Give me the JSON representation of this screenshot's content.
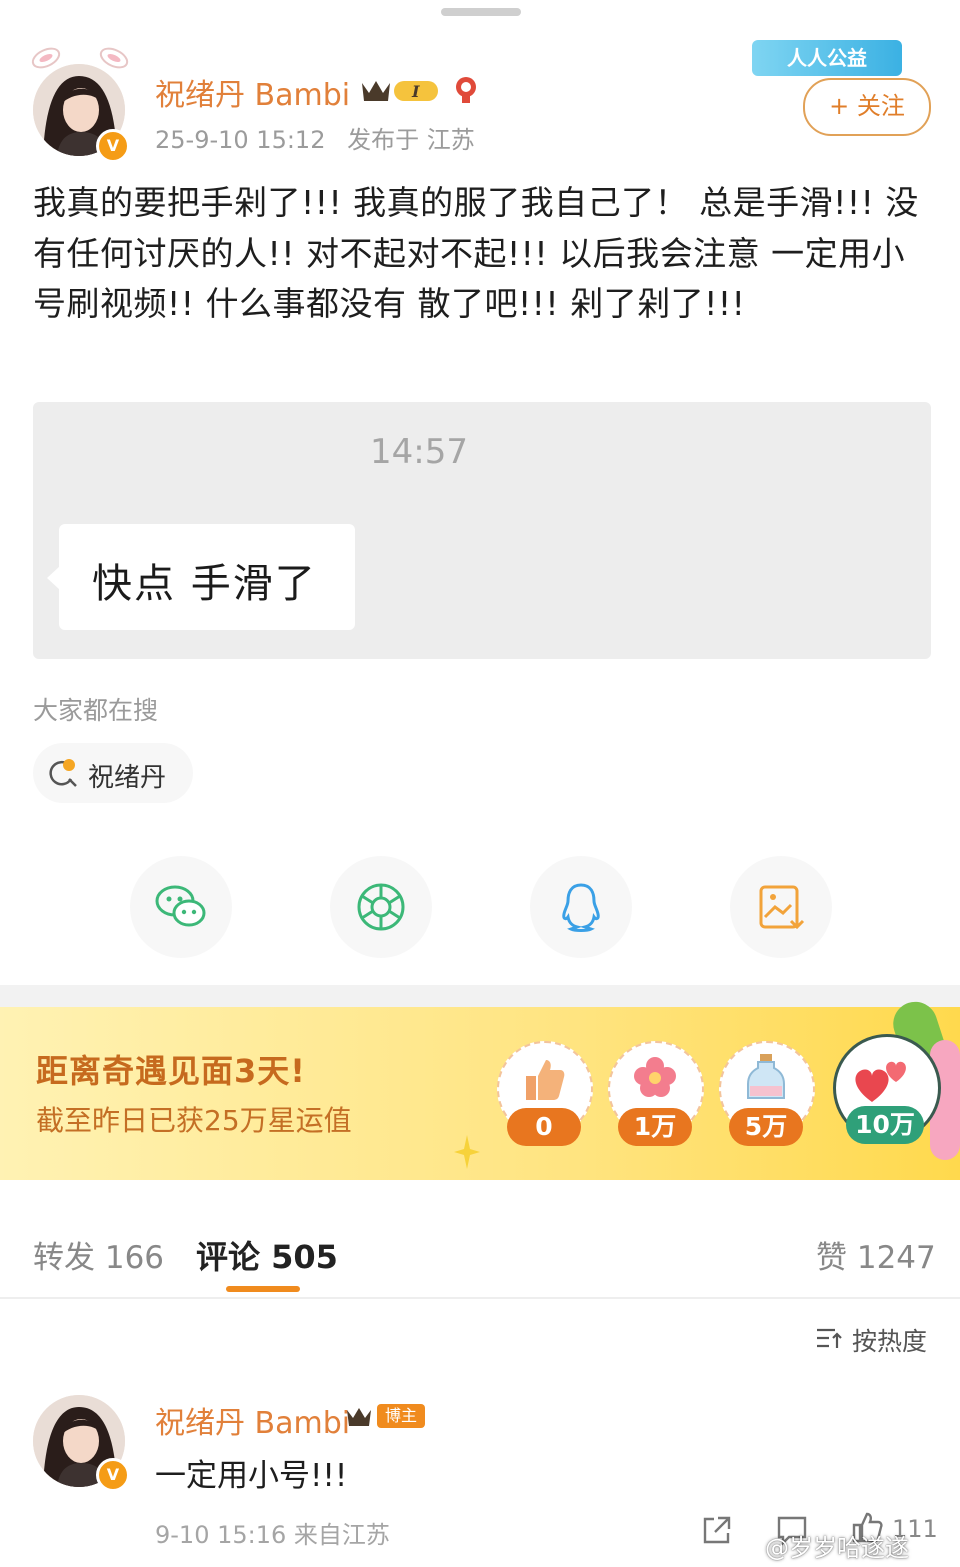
{
  "post": {
    "author": "祝绪丹 Bambi",
    "verified_mark": "V",
    "time": "25-9-10 15:12",
    "location": "发布于 江苏",
    "badge_charity": "人人公益",
    "follow_label": "+ 关注",
    "text": "我真的要把手剁了!!! 我真的服了我自己了！ 总是手滑!!! 没有任何讨厌的人!! 对不起对不起!!! 以后我会注意 一定用小号刷视频!! 什么事都没有 散了吧!!! 剁了剁了!!!",
    "image": {
      "time": "14:57",
      "message": "快点 手滑了"
    }
  },
  "search": {
    "title": "大家都在搜",
    "chip": "祝绪丹"
  },
  "share_icons": [
    "wechat-icon",
    "moments-icon",
    "qq-icon",
    "save-image-icon"
  ],
  "promo": {
    "title": "距离奇遇见面3天!",
    "subtitle": "截至昨日已获25万星运值",
    "milestones": [
      "0",
      "1万",
      "5万",
      "10万"
    ]
  },
  "tabs": {
    "repost": "转发 166",
    "comments": "评论 505",
    "likes": "赞 1247"
  },
  "sort_label": "按热度",
  "comment": {
    "author": "祝绪丹 Bambi",
    "badge": "博主",
    "text": "一定用小号!!!",
    "meta": "9-10 15:16 来自江苏",
    "likes": "111"
  },
  "watermark": "@岁岁哈遂遂",
  "colors": {
    "accent": "#f08b1e",
    "author": "#e1803a",
    "banner": "#ffe480"
  }
}
